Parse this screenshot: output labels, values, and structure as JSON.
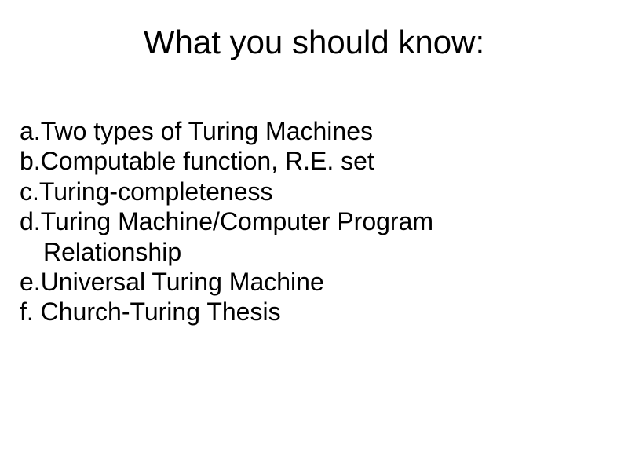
{
  "slide": {
    "title": "What you should know:",
    "items": [
      {
        "marker": "a.",
        "text": "Two types of Turing Machines"
      },
      {
        "marker": "b.",
        "text": "Computable function, R.E. set"
      },
      {
        "marker": "c.",
        "text": "Turing-completeness"
      },
      {
        "marker": "d.",
        "text": "Turing Machine/Computer Program"
      },
      {
        "marker": "",
        "text": "Relationship",
        "indent": true
      },
      {
        "marker": "e.",
        "text": "Universal Turing Machine"
      },
      {
        "marker": "f.",
        "text": " Church-Turing Thesis"
      }
    ]
  }
}
